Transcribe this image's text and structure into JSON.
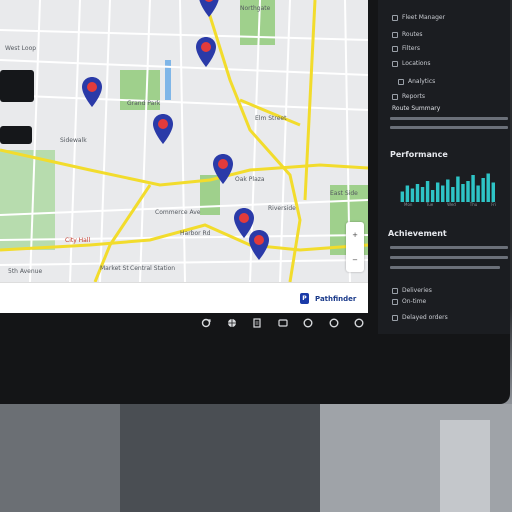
{
  "map": {
    "labels": [
      {
        "text": "Sidewalk",
        "cls": ""
      },
      {
        "text": "Grand Park",
        "cls": ""
      },
      {
        "text": "Commerce Ave",
        "cls": ""
      },
      {
        "text": "Elm Street",
        "cls": ""
      },
      {
        "text": "Oak Plaza",
        "cls": ""
      },
      {
        "text": "Riverside",
        "cls": ""
      },
      {
        "text": "Market St",
        "cls": ""
      },
      {
        "text": "Central Station",
        "cls": ""
      },
      {
        "text": "5th Avenue",
        "cls": ""
      },
      {
        "text": "Harbor Rd",
        "cls": ""
      },
      {
        "text": "City Hall",
        "cls": "red"
      },
      {
        "text": "Northgate",
        "cls": ""
      },
      {
        "text": "West Loop",
        "cls": ""
      },
      {
        "text": "East Side",
        "cls": ""
      }
    ],
    "zoom_in": "+",
    "zoom_out": "−"
  },
  "footer": {
    "link_label": "Pathfinder",
    "badge": "P"
  },
  "taskbar": {
    "icons": [
      "refresh-icon",
      "globe-icon",
      "document-icon",
      "window-icon",
      "circle-icon",
      "circle-icon",
      "circle-icon"
    ]
  },
  "side": {
    "menu": [
      {
        "label": "Fleet Manager",
        "icon": "truck-icon"
      },
      {
        "label": "Routes",
        "icon": "route-icon"
      },
      {
        "label": "Filters",
        "icon": "filter-icon"
      },
      {
        "label": "Locations",
        "icon": "pin-icon"
      },
      {
        "label": "Analytics",
        "icon": "chart-icon"
      },
      {
        "label": "Reports",
        "icon": "document-icon"
      }
    ],
    "info_title": "Route Summary",
    "perf_heading": "Performance",
    "perf_axis": [
      "Mon",
      "Tue",
      "Wed",
      "Thu",
      "Fri"
    ],
    "perf_bars": [
      0.35,
      0.55,
      0.45,
      0.6,
      0.5,
      0.7,
      0.4,
      0.65,
      0.55,
      0.75,
      0.5,
      0.85,
      0.6,
      0.7,
      0.9,
      0.55,
      0.8,
      0.95,
      0.65
    ],
    "achievement_heading": "Achievement",
    "bottom_items": [
      "Deliveries",
      "On-time",
      "Delayed orders"
    ],
    "accent": "#2ec4c6"
  }
}
